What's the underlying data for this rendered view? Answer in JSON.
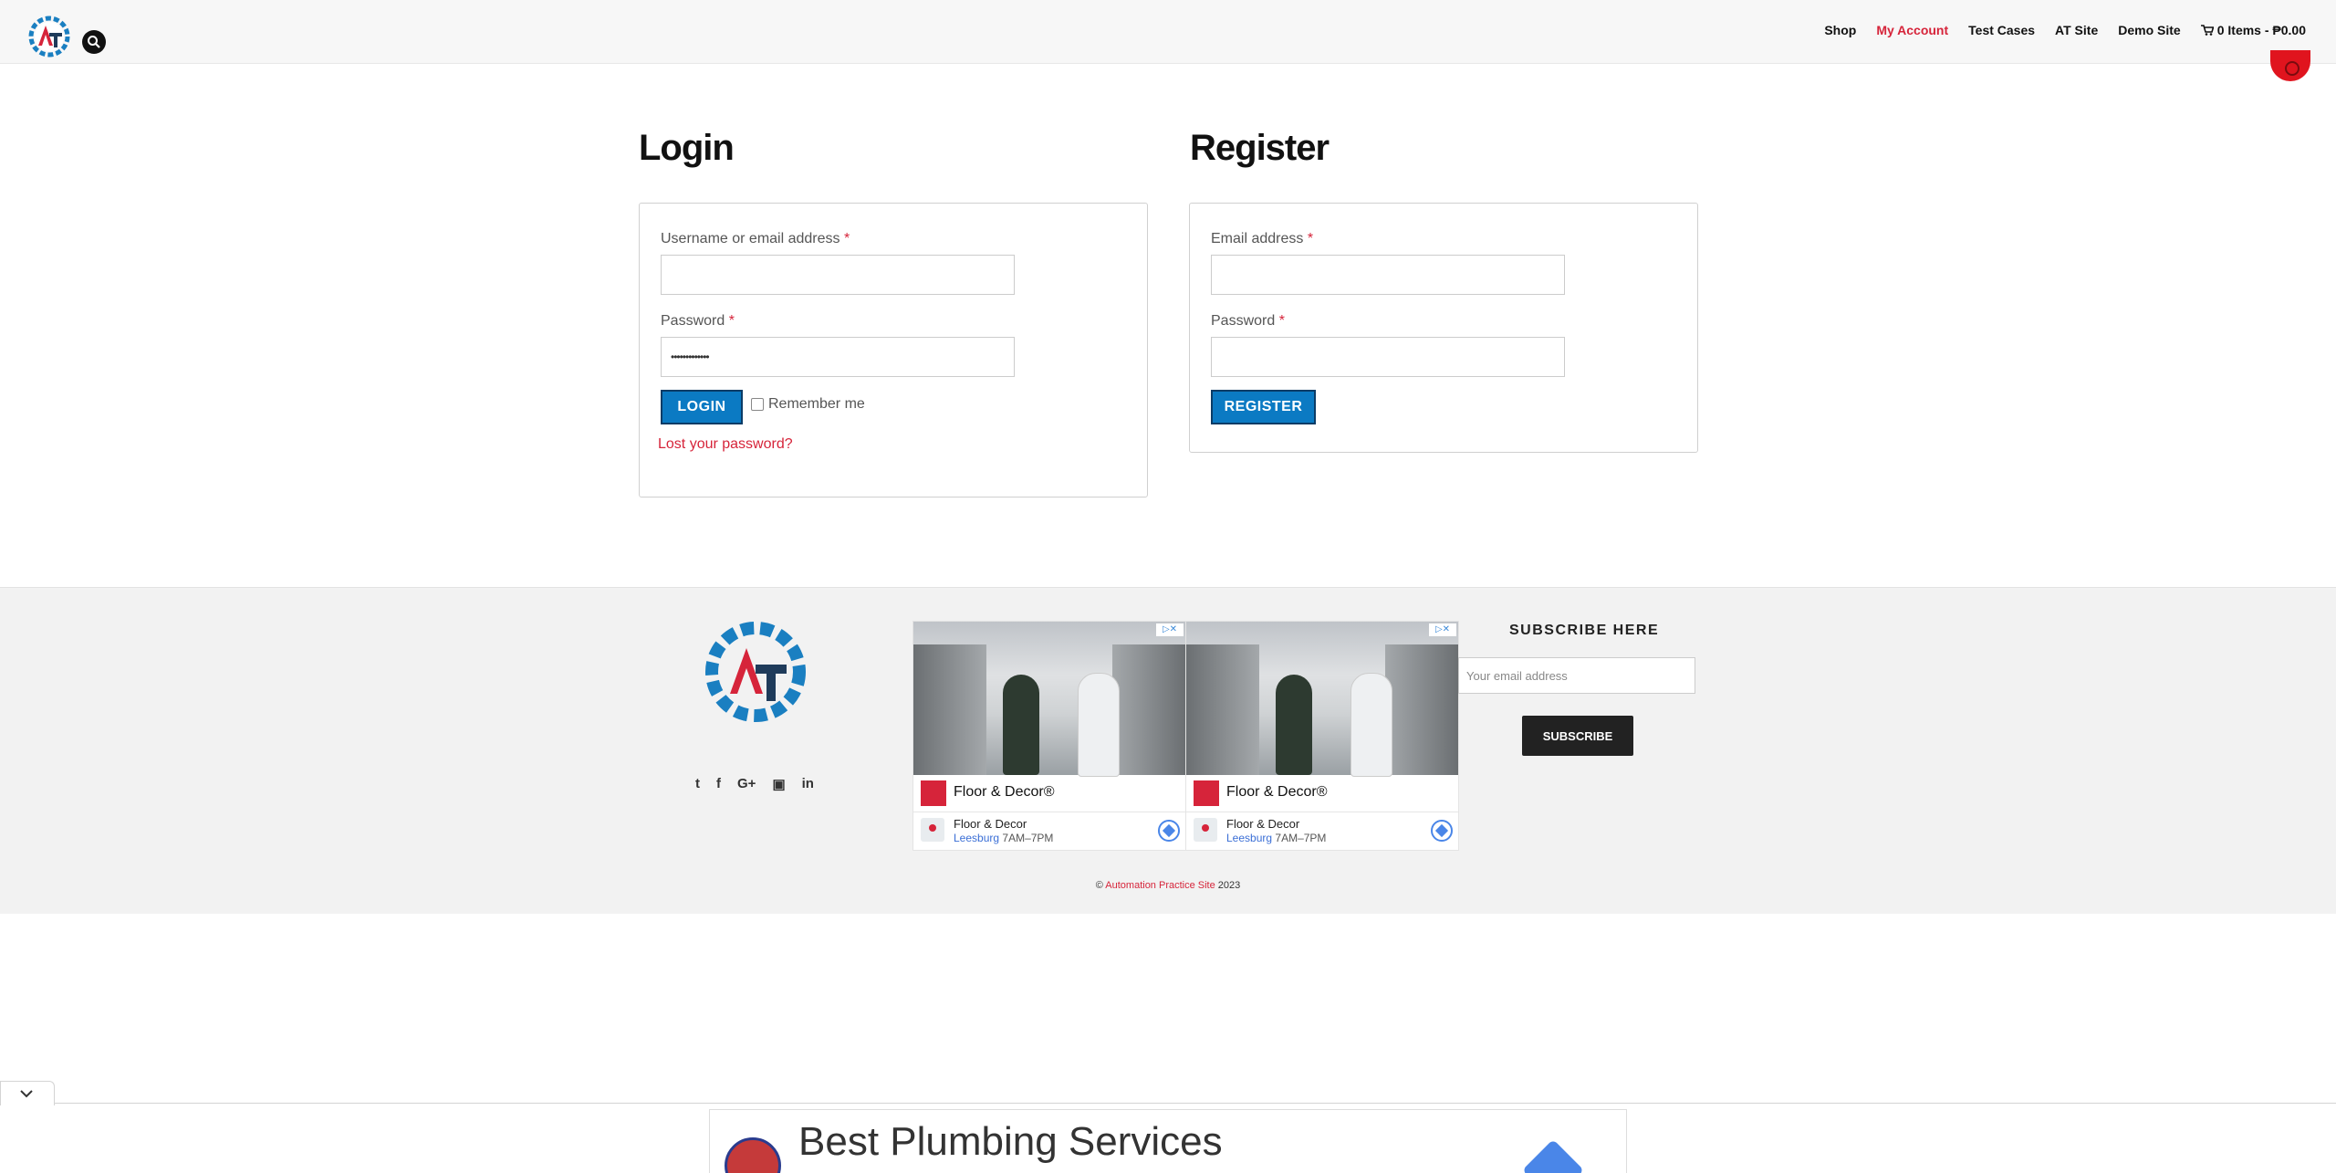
{
  "header": {
    "nav": [
      "Shop",
      "My Account",
      "Test Cases",
      "AT Site",
      "Demo Site"
    ],
    "active_nav": "My Account",
    "cart_text": "0 Items - ₱0.00"
  },
  "login": {
    "title": "Login",
    "username_label": "Username or email address",
    "password_label": "Password",
    "password_value": "•••••••••••••",
    "required_mark": "*",
    "login_button": "LOGIN",
    "remember_label": "Remember me",
    "lost_password": "Lost your password?"
  },
  "register": {
    "title": "Register",
    "email_label": "Email address",
    "password_label": "Password",
    "required_mark": "*",
    "register_button": "REGISTER"
  },
  "footer": {
    "socials": [
      "twitter-icon",
      "facebook-icon",
      "google-plus-icon",
      "youtube-icon",
      "linkedin-icon"
    ],
    "ads": [
      {
        "brand": "Floor & Decor®",
        "name": "Floor & Decor",
        "city": "Leesburg",
        "hours": "7AM–7PM"
      },
      {
        "brand": "Floor & Decor®",
        "name": "Floor & Decor",
        "city": "Leesburg",
        "hours": "7AM–7PM"
      }
    ],
    "subscribe_title": "SUBSCRIBE HERE",
    "subscribe_placeholder": "Your email address",
    "subscribe_button": "SUBSCRIBE",
    "copyright_prefix": "©",
    "copyright_link": "Automation Practice Site",
    "copyright_year": "2023"
  },
  "bottom_ad": {
    "headline": "Best Plumbing Services"
  },
  "colors": {
    "accent_red": "#d6243a",
    "button_blue": "#0b7ac3",
    "logo_blue": "#1a7fc1",
    "logo_dark": "#1f3b5a"
  }
}
